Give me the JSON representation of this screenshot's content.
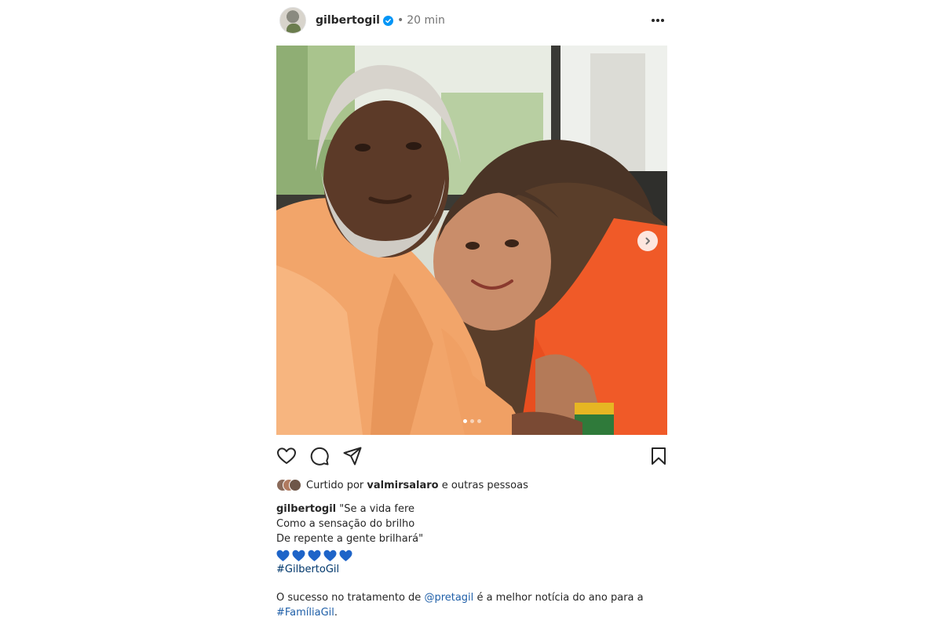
{
  "header": {
    "username": "gilbertogil",
    "time": "20 min",
    "separator": "•"
  },
  "photo": {
    "slide_count": 3,
    "active_slide": 1
  },
  "icons": {
    "like": "heart-outline-icon",
    "comment": "comment-icon",
    "share": "send-icon",
    "save": "bookmark-icon",
    "more": "more-options-icon",
    "next": "chevron-right-icon",
    "verified": "verified-badge-icon"
  },
  "likes": {
    "prefix": "Curtido por",
    "liker": "valmirsalaro",
    "suffix": "e outras pessoas"
  },
  "caption": {
    "username": "gilbertogil",
    "line1": "\"Se a vida fere",
    "line2": "Como a sensação do brilho",
    "line3": "De repente a gente brilhará\"",
    "hashtag": "#GilbertoGil"
  },
  "news": {
    "text_before": "O sucesso no tratamento de",
    "mention": "@pretagil",
    "text_after": "é a melhor notícia do ano para a",
    "hashtag": "#FamíliaGil",
    "end": "."
  },
  "colors": {
    "verified": "#0095f6",
    "heart_emoji": "#1e64c8",
    "link": "#00376b"
  }
}
